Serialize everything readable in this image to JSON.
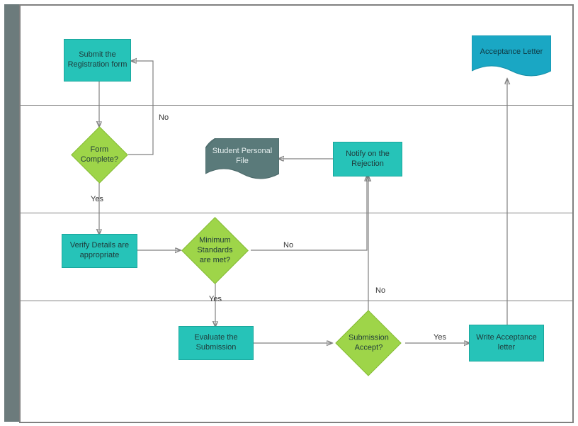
{
  "diagram": {
    "type": "swimlane-flowchart",
    "nodes": {
      "submit": {
        "label": "Submit the Registration form",
        "kind": "process"
      },
      "formComplete": {
        "label": "Form Complete?",
        "kind": "decision"
      },
      "verify": {
        "label": "Verify Details are appropriate",
        "kind": "process"
      },
      "standards": {
        "label": "Minimum Standards  are met?",
        "kind": "decision"
      },
      "studentFile": {
        "label": "Student Personal File",
        "kind": "document"
      },
      "notifyReject": {
        "label": "Notify on the Rejection",
        "kind": "process"
      },
      "evaluate": {
        "label": "Evaluate the Submission",
        "kind": "process"
      },
      "submissionAccept": {
        "label": "Submission Accept?",
        "kind": "decision"
      },
      "writeAccept": {
        "label": "Write Acceptance letter",
        "kind": "process"
      },
      "acceptLetter": {
        "label": "Acceptance Letter",
        "kind": "document"
      }
    },
    "edges": {
      "yes1": "Yes",
      "no1": "No",
      "yes2": "Yes",
      "no2": "No",
      "yes3": "Yes",
      "no3": "No"
    }
  }
}
